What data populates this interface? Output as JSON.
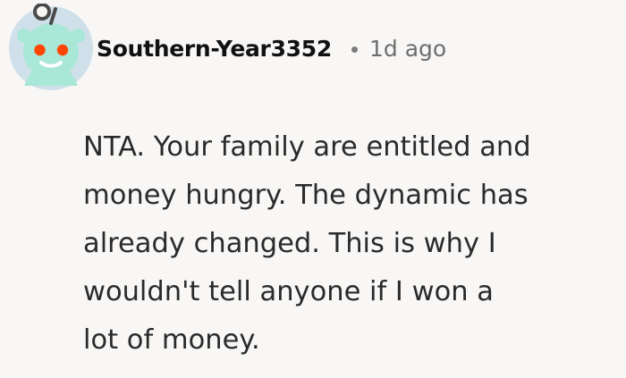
{
  "comment": {
    "author": "Southern-Year3352",
    "timestamp": "1d ago",
    "body_lines": [
      "NTA. Your family are entitled and",
      "money hungry. The dynamic has",
      "already changed. This is why I",
      "wouldn't tell anyone if I won a",
      "lot of money."
    ]
  },
  "avatar": {
    "icon": "snoo-avatar-icon",
    "background_color": "#cfe0ea",
    "body_color": "#a9e7d6",
    "eye_color": "#ff4500"
  },
  "colors": {
    "page_background": "#f8f7f6",
    "username_text": "#111111",
    "meta_text": "#6e6e6e",
    "body_text": "#2a2a2a"
  }
}
